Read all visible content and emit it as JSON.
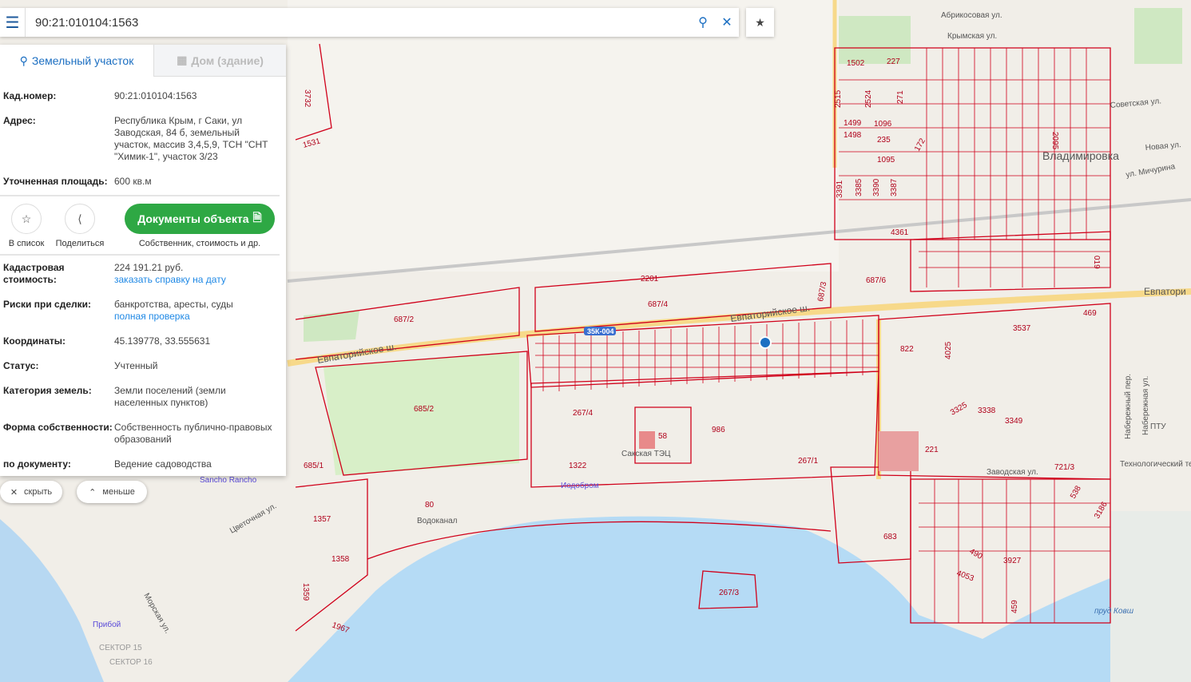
{
  "search": {
    "value": "90:21:010104:1563"
  },
  "tabs": [
    {
      "label": "Земельный участок"
    },
    {
      "label": "Дом (здание)"
    }
  ],
  "details": {
    "kad_label": "Кад.номер:",
    "kad_value": "90:21:010104:1563",
    "addr_label": "Адрес:",
    "addr_value": "Республика Крым, г Саки, ул Заводская, 84 б, земельный участок, массив 3,4,5,9, ТСН \"СНТ \"Химик-1\", участок 3/23",
    "area_label": "Уточненная площадь:",
    "area_value": "600 кв.м",
    "cost_label": "Кадастровая стоимость:",
    "cost_value": "224 191.21 руб.",
    "cost_link": "заказать справку на дату",
    "risk_label": "Риски при сделки:",
    "risk_value": "банкротства, аресты, суды",
    "risk_link": "полная проверка",
    "coord_label": "Координаты:",
    "coord_value": "45.139778, 33.555631",
    "status_label": "Статус:",
    "status_value": "Учтенный",
    "cat_label": "Категория земель:",
    "cat_value": "Земли поселений (земли населенных пунктов)",
    "own_label": "Форма собственности:",
    "own_value": "Собственность публично-правовых образований",
    "doc_label": "по документу:",
    "doc_value": "Ведение садоводства"
  },
  "actions": {
    "fav": "В список",
    "share": "Поделиться",
    "docs": "Документы объекта",
    "docs_sub": "Собственник, стоимость и др."
  },
  "bottom": {
    "hide": "скрыть",
    "less": "меньше"
  },
  "map": {
    "parcels": [
      "3732",
      "1531",
      "687/2",
      "687/4",
      "687/3",
      "687/6",
      "685/2",
      "685/1",
      "267/4",
      "58",
      "986",
      "1322",
      "267/1",
      "80",
      "1357",
      "1358",
      "1359",
      "1967",
      "267/3",
      "683",
      "1502",
      "227",
      "2515",
      "2524",
      "271",
      "1499",
      "1498",
      "1096",
      "235",
      "1095",
      "172",
      "2095",
      "3391",
      "3385",
      "3390",
      "3387",
      "4361",
      "019",
      "469",
      "3537",
      "822",
      "4025",
      "3325",
      "3338",
      "3349",
      "221",
      "721/3",
      "538",
      "3186",
      "490",
      "3927",
      "4053",
      "459",
      "2201"
    ],
    "streets": [
      "Евпаторийское ш.",
      "Евпаторийское ш.",
      "Абрикосовая ул.",
      "Крымская ул.",
      "Советская ул.",
      "Новая ул.",
      "ул. Мичурина",
      "Евпатори",
      "Заводская ул.",
      "Цветочная ул.",
      "Морская ул.",
      "Набережный пер.",
      "Набережная ул."
    ],
    "places": [
      "Владимировка",
      "Сакская ТЭЦ",
      "Водоканал",
      "Иодобром",
      "Sancho Rancho",
      "Прибой",
      "СЕКТОР 15",
      "СЕКТОР 16",
      "ПТУ",
      "Технологический техникум",
      "пруд Ковш",
      "35К-004"
    ]
  }
}
